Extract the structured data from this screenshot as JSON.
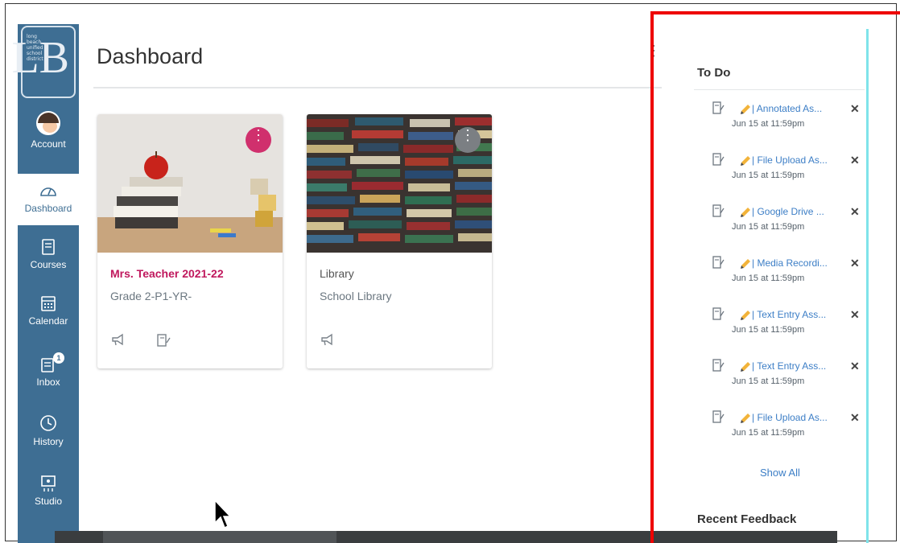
{
  "nav": {
    "logo_lines": [
      "long",
      "beach",
      "unified",
      "school",
      "district"
    ],
    "logo_letter": "LB",
    "items": [
      {
        "label": "Account",
        "icon": "avatar"
      },
      {
        "label": "Dashboard",
        "icon": "dashboard-icon"
      },
      {
        "label": "Courses",
        "icon": "courses-icon"
      },
      {
        "label": "Calendar",
        "icon": "calendar-icon"
      },
      {
        "label": "Inbox",
        "icon": "inbox-icon",
        "badge": "1"
      },
      {
        "label": "History",
        "icon": "clock-icon"
      },
      {
        "label": "Studio",
        "icon": "studio-icon"
      }
    ]
  },
  "header": {
    "title": "Dashboard"
  },
  "cards": [
    {
      "title": "Mrs. Teacher 2021-22",
      "subtitle": "Grade 2-P1-YR-",
      "title_color": "#c0185d",
      "menu_color": "#d0306d"
    },
    {
      "title": "Library",
      "subtitle": "School Library",
      "title_color": "#555555",
      "menu_color": "#7b7f83"
    }
  ],
  "todo": {
    "heading": "To Do",
    "items": [
      {
        "title": "| Annotated As...",
        "due": "Jun 15 at 11:59pm"
      },
      {
        "title": "| File Upload As...",
        "due": "Jun 15 at 11:59pm"
      },
      {
        "title": "| Google Drive ...",
        "due": "Jun 15 at 11:59pm"
      },
      {
        "title": "| Media Recordi...",
        "due": "Jun 15 at 11:59pm"
      },
      {
        "title": "| Text Entry Ass...",
        "due": "Jun 15 at 11:59pm"
      },
      {
        "title": "| Text Entry Ass...",
        "due": "Jun 15 at 11:59pm"
      },
      {
        "title": "| File Upload As...",
        "due": "Jun 15 at 11:59pm"
      }
    ],
    "show_all": "Show All",
    "dismiss_glyph": "✕"
  },
  "recent_feedback": {
    "heading": "Recent Feedback"
  },
  "colors": {
    "nav_bg": "#3e6e93",
    "link": "#3c7ec6",
    "annotation": "#ee0000"
  }
}
